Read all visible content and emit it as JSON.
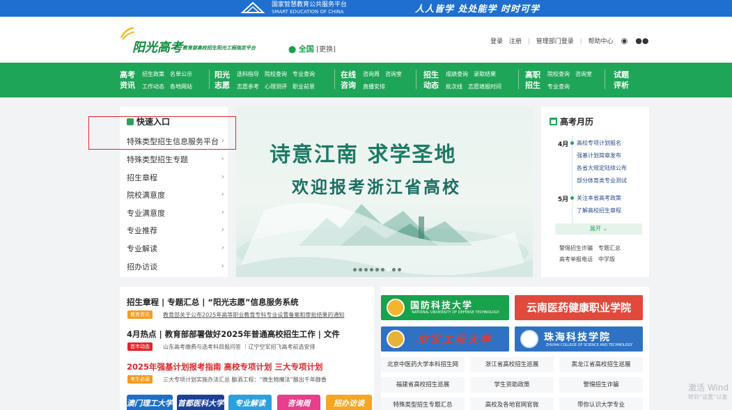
{
  "topbar": {
    "platform_name_cn": "国家智慧教育公共服务平台",
    "platform_name_en": "SMART EDUCATION OF CHINA",
    "slogan": "人人皆学 处处能学 时时可学"
  },
  "header": {
    "logo_text": "阳光高考",
    "logo_subtitle": "教育部高校招生阳光工程指定平台",
    "location": "全国",
    "location_switch": "[更换]",
    "links": [
      "登录",
      "注册",
      "|",
      "管理部门登录",
      "|",
      "帮助中心"
    ]
  },
  "nav": {
    "groups": [
      {
        "title": "高考资讯",
        "row1": [
          "招生政策",
          "名单公示"
        ],
        "row2": [
          "工作动态",
          "各地网站"
        ]
      },
      {
        "title": "阳光志愿",
        "row1": [
          "选科指导",
          "院校查询",
          "专业查询"
        ],
        "row2": [
          "志愿参考",
          "心理测评",
          "职业前景"
        ]
      },
      {
        "title": "在线咨询",
        "row1": [
          "咨询周",
          "咨询室"
        ],
        "row2": [
          "直播安排"
        ]
      },
      {
        "title": "招生动态",
        "row1": [
          "成绩查询",
          "录取结果"
        ],
        "row2": [
          "批次线",
          "志愿填报时间"
        ]
      },
      {
        "title": "高职招生",
        "row1": [
          "院校查询",
          "咨询室"
        ],
        "row2": [
          "专业查询"
        ]
      },
      {
        "title": "试题评析",
        "row1": [],
        "row2": []
      }
    ]
  },
  "quick": {
    "title": "快速入口",
    "items": [
      "特殊类型招生信息服务平台",
      "特殊类型招生专题",
      "招生章程",
      "院校满意度",
      "专业满意度",
      "专业推荐",
      "专业解读",
      "招办访谈"
    ],
    "arrow": "›"
  },
  "banner": {
    "title_line1": "诗意江南  求学圣地",
    "title_line2": "欢迎报考浙江省高校",
    "dots": 9,
    "active_dot": 6
  },
  "calendar": {
    "title": "高考月历",
    "months": [
      {
        "label": "4月",
        "items": [
          "高校专项计划报名",
          "强基计划简章发布",
          "各省大规定陆续公布",
          "部分体育类专业测试"
        ]
      },
      {
        "label": "5月",
        "items": [
          "关注本省高考政策",
          "了解高校招生章程"
        ]
      }
    ],
    "more": "展开",
    "footer_row1": [
      "警惕招生诈骗",
      "专题汇总"
    ],
    "footer_row2": [
      "高考举报电话",
      "中学版"
    ]
  },
  "news": {
    "h1": "招生章程 | 专题汇总 | “阳光志愿”信息服务系统",
    "tag1": "教育资讯",
    "sub1": "教育部关于公布2025年高等职业教育专科专业设置备案和审批结果的通知",
    "h2": "4月热点 | 教育部部署做好2025年普通高校招生工作 | 文件",
    "tag2": "首市动态",
    "sub2": "山东高考缴费与选考科目报问答 ｜辽宁空军招飞高考前选安排",
    "h3": "2025年强基计划报考指南   高校专项计划   三大专项计划",
    "tag3": "考生必读",
    "sub3": "三大专项计划实施办法汇总    酿酒工程：“微生物魔法”酿出千年醇香",
    "bottom_buttons": [
      "澳门理工大学",
      "首都医科大学",
      "专业解读",
      "咨询周",
      "招办访谈"
    ]
  },
  "universities": {
    "cards": [
      {
        "name": "国防科技大学",
        "sub": "NATIONAL UNIVERSITY OF DEFENSE TECHNOLOGY",
        "color": "#18a24c"
      },
      {
        "name": "云南医药健康职业学院",
        "sub": "",
        "color": "#e04a3c"
      },
      {
        "name": "空军工程大学",
        "sub": "",
        "color": "#2f72c4"
      },
      {
        "name": "珠海科技学院",
        "sub": "ZHUHAI COLLEGE OF SCIENCE AND TECHNOLOGY",
        "color": "#2f72c4"
      }
    ],
    "links": [
      "北京中医药大学本科招生网",
      "浙江省高校招生巡展",
      "黑龙江省高校招生巡展",
      "福建省高校招生巡展",
      "学生资助政策",
      "警惕招生诈骗",
      "特殊类型招生专题汇总",
      "高校及各地官网官微",
      "带你认识大学专业"
    ]
  },
  "watermark": {
    "line1": "激活 Wind",
    "line2": "转到“设置”以激"
  }
}
